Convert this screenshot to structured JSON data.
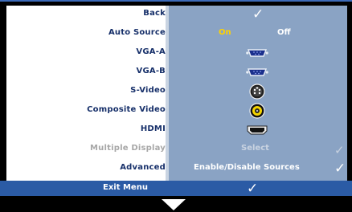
{
  "menu": {
    "rows": [
      {
        "label": "Back"
      },
      {
        "label": "Auto Source",
        "on": "On",
        "off": "Off"
      },
      {
        "label": "VGA-A",
        "icon": "vga-connector-icon"
      },
      {
        "label": "VGA-B",
        "icon": "vga-connector-icon"
      },
      {
        "label": "S-Video",
        "icon": "s-video-connector-icon"
      },
      {
        "label": "Composite Video",
        "icon": "composite-video-connector-icon"
      },
      {
        "label": "HDMI",
        "icon": "hdmi-connector-icon"
      },
      {
        "label": "Multiple Display",
        "value": "Select",
        "disabled": true
      },
      {
        "label": "Advanced",
        "value": "Enable/Disable Sources"
      }
    ]
  },
  "exit": {
    "label": "Exit Menu"
  },
  "colors": {
    "accent": "#2b5ba5",
    "on": "#ffd200",
    "panel": "#8aa3c4",
    "label": "#17306a"
  }
}
